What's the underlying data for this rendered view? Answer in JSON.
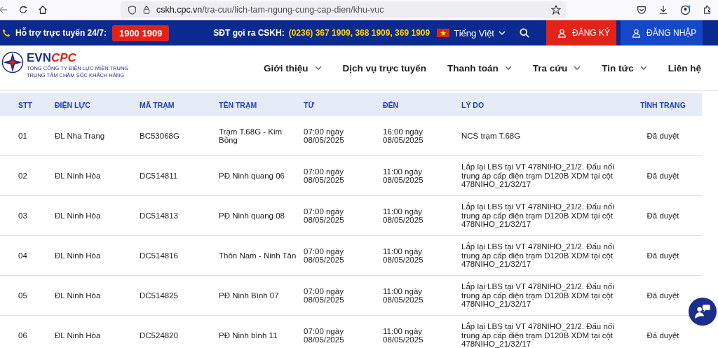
{
  "browser": {
    "url_host": "cskh.cpc.vn",
    "url_path": "/tra-cuu/lich-tam-ngung-cung-cap-dien/khu-vuc"
  },
  "top_bar": {
    "support_label": "Hỗ trợ trực tuyến 24/7:",
    "hotline": "1900 1909",
    "call_label": "SĐT gọi ra CSKH:",
    "call_numbers": "(0236) 367 1909, 368 1909, 369 1909",
    "language": "Tiếng Việt",
    "register": "ĐĂNG KÝ",
    "login": "ĐĂNG NHẬP"
  },
  "header": {
    "logo_main": "EVN",
    "logo_accent": "CPC",
    "logo_line_1": "TỔNG CÔNG TY ĐIỆN LỰC MIỀN TRUNG",
    "logo_line_2": "TRUNG TÂM CHĂM SÓC KHÁCH HÀNG",
    "nav": [
      {
        "label": "Giới thiệu",
        "has_dropdown": true
      },
      {
        "label": "Dịch vụ trực tuyến",
        "has_dropdown": false
      },
      {
        "label": "Thanh toán",
        "has_dropdown": true
      },
      {
        "label": "Tra cứu",
        "has_dropdown": true
      },
      {
        "label": "Tin tức",
        "has_dropdown": true
      },
      {
        "label": "Liên hệ",
        "has_dropdown": false
      }
    ]
  },
  "table": {
    "columns": [
      "STT",
      "ĐIỆN LỰC",
      "MÃ TRẠM",
      "TÊN TRẠM",
      "TỪ",
      "ĐẾN",
      "LÝ DO",
      "TÌNH TRẠNG"
    ],
    "rows": [
      [
        "01",
        "ĐL Nha Trang",
        "BC53068G",
        "Trạm T.68G - Kim Bồng",
        "07:00 ngày 08/05/2025",
        "16:00 ngày 08/05/2025",
        "NCS trạm T.68G",
        "Đã duyệt"
      ],
      [
        "02",
        "ĐL Ninh Hòa",
        "DC514811",
        "PĐ Ninh quang 06",
        "07:00 ngày 08/05/2025",
        "11:00 ngày 08/05/2025",
        "Lắp lại LBS tại VT 478NIHO_21/2. Đấu nối trung áp cấp điện trạm D120B XDM tại cột 478NIHO_21/32/17",
        "Đã duyệt"
      ],
      [
        "03",
        "ĐL Ninh Hòa",
        "DC514813",
        "PĐ Ninh quang 08",
        "07:00 ngày 08/05/2025",
        "11:00 ngày 08/05/2025",
        "Lắp lại LBS tại VT 478NIHO_21/2. Đấu nối trung áp cấp điện trạm D120B XDM tại cột 478NIHO_21/32/17",
        "Đã duyệt"
      ],
      [
        "04",
        "ĐL Ninh Hòa",
        "DC514816",
        "Thôn Nam - Ninh Tân",
        "07:00 ngày 08/05/2025",
        "11:00 ngày 08/05/2025",
        "Lắp lại LBS tại VT 478NIHO_21/2. Đấu nối trung áp cấp điện trạm D120B XDM tại cột 478NIHO_21/32/17",
        "Đã duyệt"
      ],
      [
        "05",
        "ĐL Ninh Hòa",
        "DC514825",
        "PĐ Ninh Bình 07",
        "07:00 ngày 08/05/2025",
        "11:00 ngày 08/05/2025",
        "Lắp lại LBS tại VT 478NIHO_21/2. Đấu nối trung áp cấp điện trạm D120B XDM tại cột 478NIHO_21/32/17",
        "Đã duyệt"
      ],
      [
        "06",
        "ĐL Ninh Hòa",
        "DC524820",
        "PĐ Ninh bình 11",
        "07:00 ngày 08/05/2025",
        "11:00 ngày 08/05/2025",
        "Lắp lại LBS tại VT 478NIHO_21/2. Đấu nối trung áp cấp điện trạm D120B XDM tại cột 478NIHO_21/32/17",
        "Đã duyệt"
      ]
    ]
  }
}
